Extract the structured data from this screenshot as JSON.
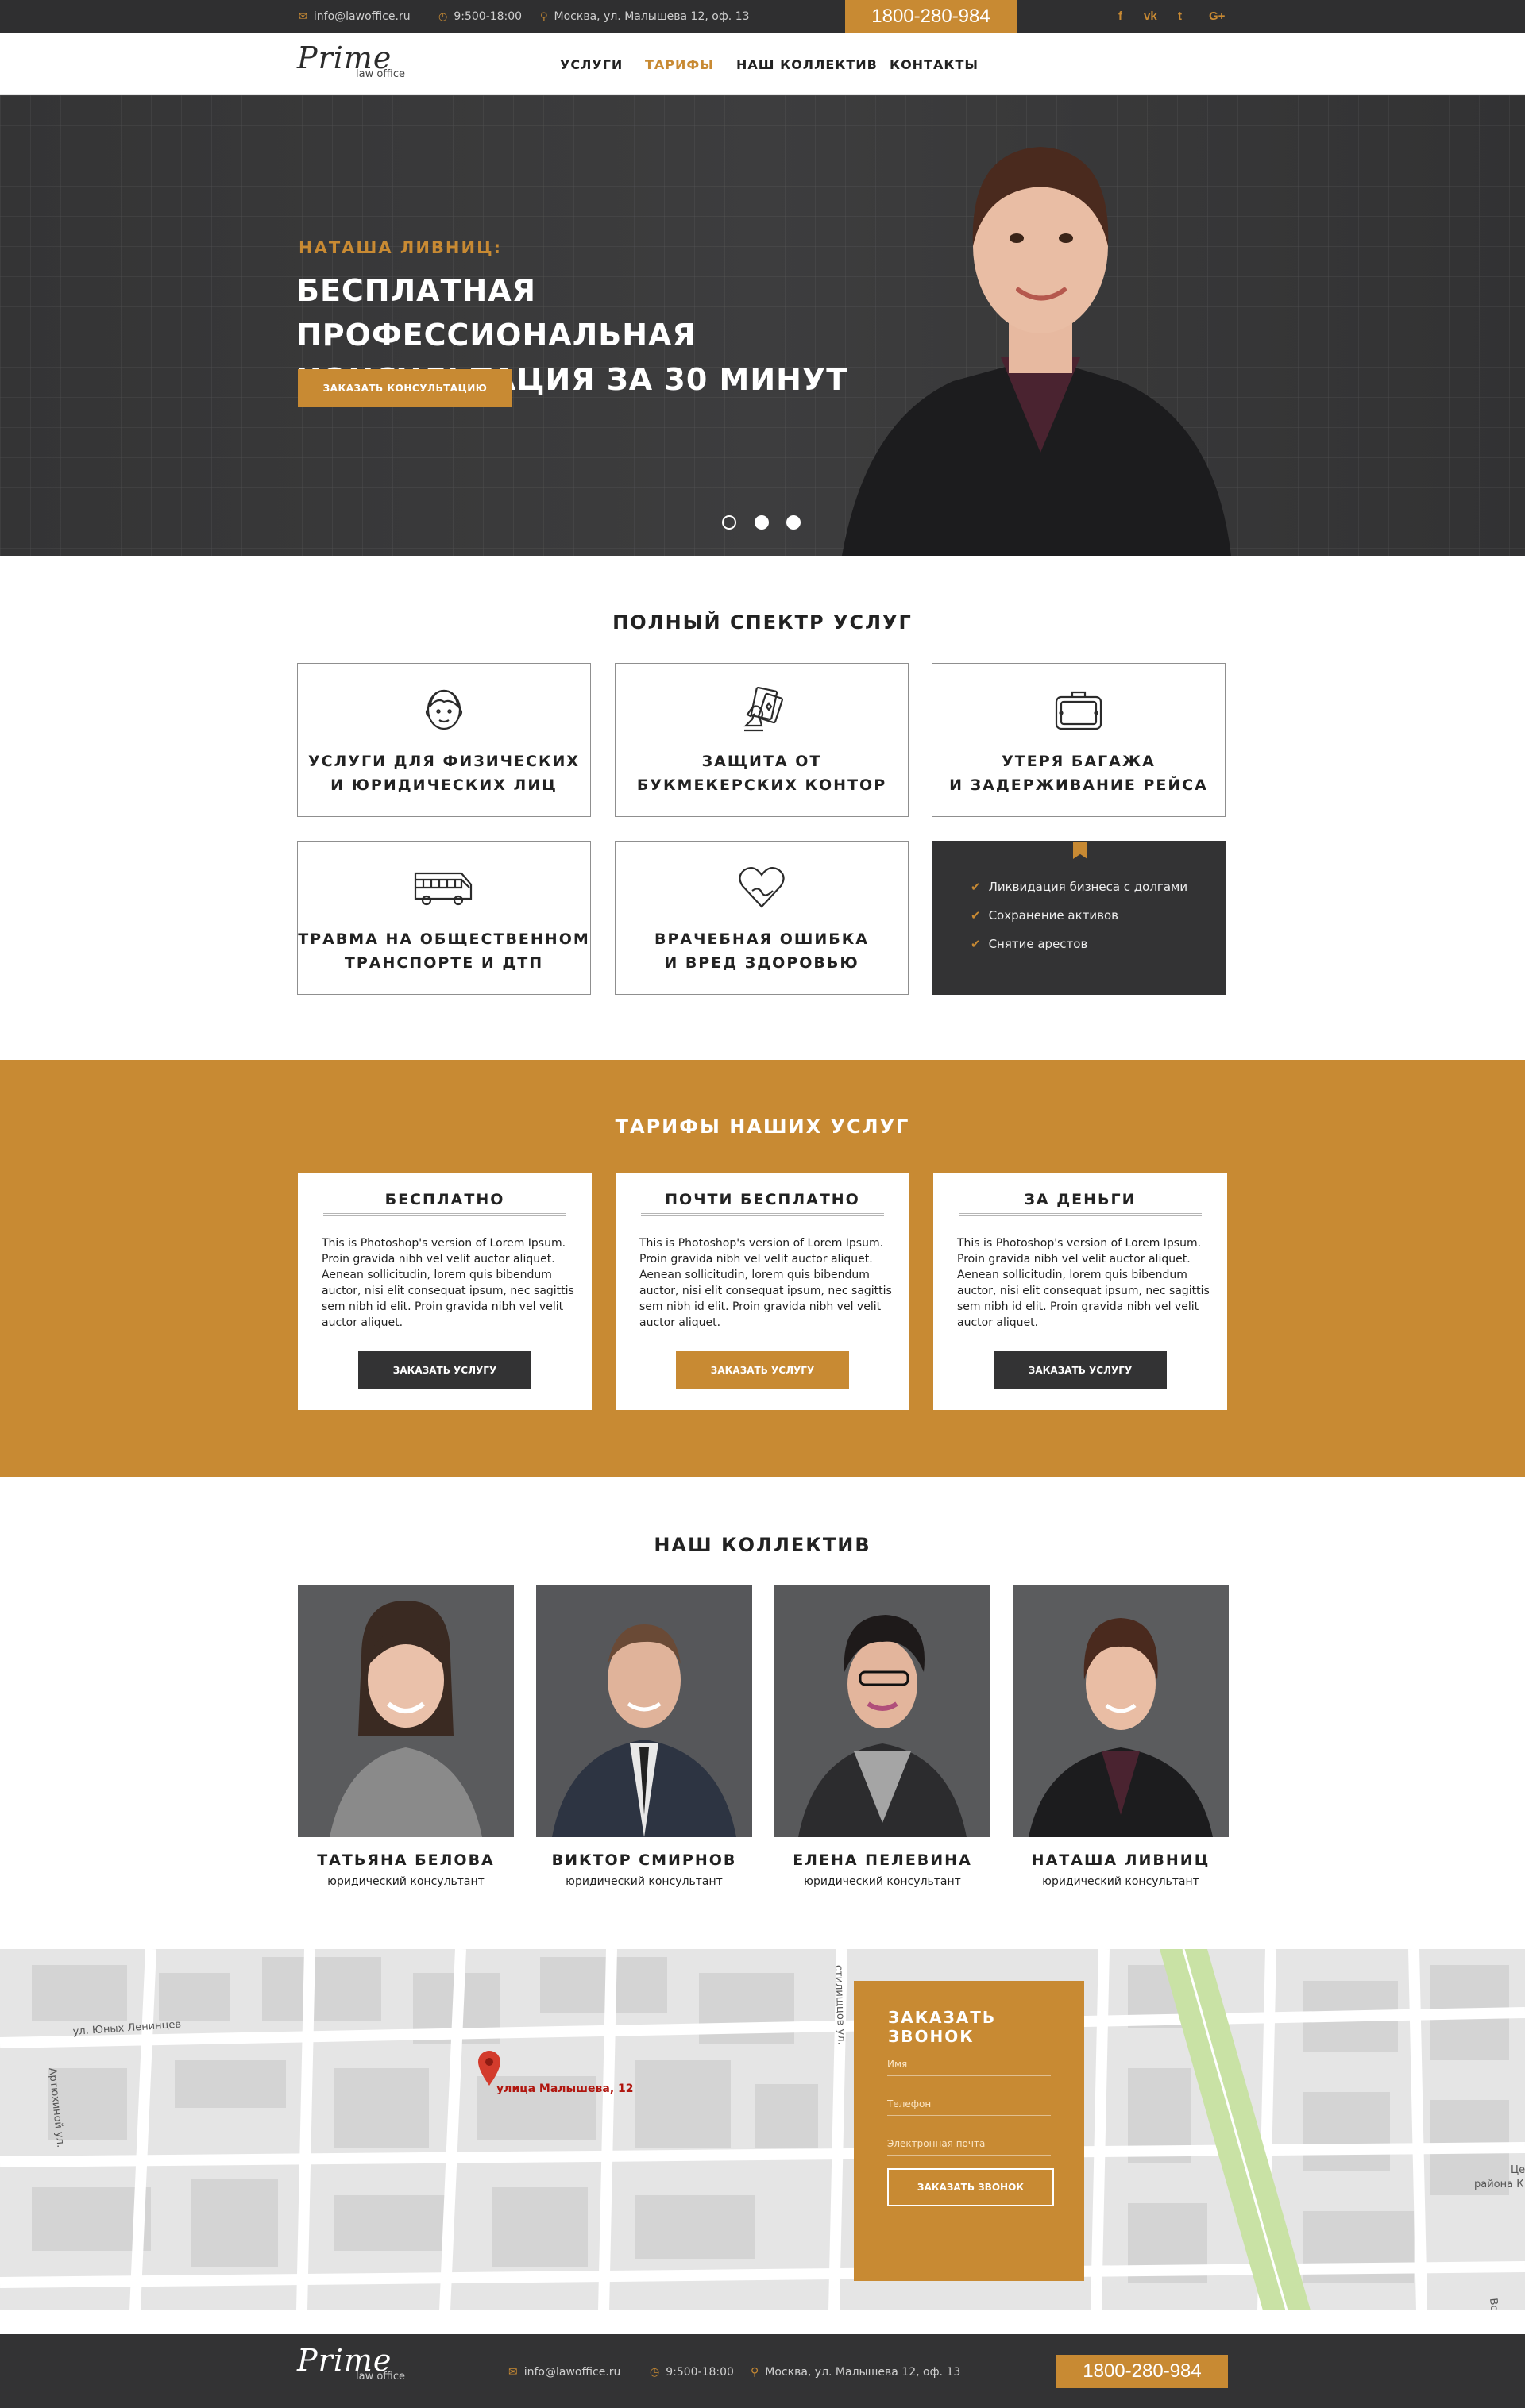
{
  "topbar": {
    "email": "info@lawoffice.ru",
    "hours": "9:500-18:00",
    "address": "Москва, ул. Малышева 12, оф. 13",
    "phone": "1800-280-984",
    "social": [
      "f",
      "vk",
      "t",
      "G+"
    ]
  },
  "logo": {
    "title": "Prime",
    "subtitle": "law office"
  },
  "nav": {
    "items": [
      "УСЛУГИ",
      "ТАРИФЫ",
      "НАШ КОЛЛЕКТИВ",
      "КОНТАКТЫ"
    ],
    "active": "ТАРИФЫ"
  },
  "hero": {
    "subtitle": "НАТАША ЛИВНИЦ:",
    "title": "БЕСПЛАТНАЯ ПРОФЕССИОНАЛЬНАЯ КОНСУЛЬТАЦИЯ ЗА 30 МИНУТ",
    "button": "ЗАКАЗАТЬ КОНСУЛЬТАЦИЮ",
    "slide_count": 3,
    "active_slide": 1
  },
  "services": {
    "title": "ПОЛНЫЙ СПЕКТР УСЛУГ",
    "cards": [
      {
        "line1": "УСЛУГИ ДЛЯ ФИЗИЧЕСКИХ",
        "line2": "И ЮРИДИЧЕСКИХ ЛИЦ",
        "icon": "person-icon"
      },
      {
        "line1": "ЗАЩИТА ОТ",
        "line2": "БУКМЕКЕРСКИХ КОНТОР",
        "icon": "cards-chess-icon"
      },
      {
        "line1": "УТЕРЯ БАГАЖА",
        "line2": "И ЗАДЕРЖИВАНИЕ РЕЙСА",
        "icon": "suitcase-icon"
      },
      {
        "line1": "ТРАВМА НА ОБЩЕСТВЕННОМ",
        "line2": "ТРАНСПОРТЕ И ДТП",
        "icon": "bus-icon"
      },
      {
        "line1": "ВРАЧЕБНАЯ ОШИБКА",
        "line2": "И ВРЕД ЗДОРОВЬЮ",
        "icon": "heart-icon"
      }
    ],
    "extra_list": [
      "Ликвидация бизнеса с долгами",
      "Сохранение активов",
      "Снятие арестов"
    ]
  },
  "tariffs": {
    "title": "ТАРИФЫ НАШИХ УСЛУГ",
    "cards": [
      {
        "name": "БЕСПЛАТНО",
        "text": "This is Photoshop's version  of Lorem Ipsum. Proin gravida nibh vel velit auctor aliquet. Aenean sollicitudin, lorem quis bibendum auctor, nisi elit consequat ipsum, nec sagittis sem nibh id elit. Proin gravida nibh vel velit auctor aliquet.",
        "button": "ЗАКАЗАТЬ УСЛУГУ"
      },
      {
        "name": "ПОЧТИ БЕСПЛАТНО",
        "text": "This is Photoshop's version  of Lorem Ipsum. Proin gravida nibh vel velit auctor aliquet. Aenean sollicitudin, lorem quis bibendum auctor, nisi elit consequat ipsum, nec sagittis sem nibh id elit. Proin gravida nibh vel velit auctor aliquet.",
        "button": "ЗАКАЗАТЬ УСЛУГУ"
      },
      {
        "name": "ЗА ДЕНЬГИ",
        "text": "This is Photoshop's version  of Lorem Ipsum. Proin gravida nibh vel velit auctor aliquet. Aenean sollicitudin, lorem quis bibendum auctor, nisi elit consequat ipsum, nec sagittis sem nibh id elit. Proin gravida nibh vel velit auctor aliquet.",
        "button": "ЗАКАЗАТЬ УСЛУГУ"
      }
    ]
  },
  "team": {
    "title": "НАШ КОЛЛЕКТИВ",
    "members": [
      {
        "name": "ТАТЬЯНА БЕЛОВА",
        "role": "юридический консультант"
      },
      {
        "name": "ВИКТОР СМИРНОВ",
        "role": "юридический консультант"
      },
      {
        "name": "ЕЛЕНА ПЕЛЕВИНА",
        "role": "юридический консультант"
      },
      {
        "name": "НАТАША ЛИВНИЦ",
        "role": "юридический консультант"
      }
    ]
  },
  "map": {
    "pin_label": "улица Малышева, 12",
    "streets": [
      "ул. Юных Ленинцев",
      "Артюхиной ул.",
      "стилищцов ул.",
      "Цент",
      "района К",
      "Вол"
    ]
  },
  "callback": {
    "title": "ЗАКАЗАТЬ ЗВОНОК",
    "name_placeholder": "Имя",
    "phone_placeholder": "Телефон",
    "email_placeholder": "Электронная почта",
    "button": "ЗАКАЗАТЬ ЗВОНОК"
  },
  "footer": {
    "email": "info@lawoffice.ru",
    "hours": "9:500-18:00",
    "address": "Москва, ул. Малышева 12, оф. 13",
    "phone": "1800-280-984"
  },
  "colors": {
    "accent": "#c88a33",
    "dark": "#333334",
    "hero_bg": "#3a3a3b"
  }
}
